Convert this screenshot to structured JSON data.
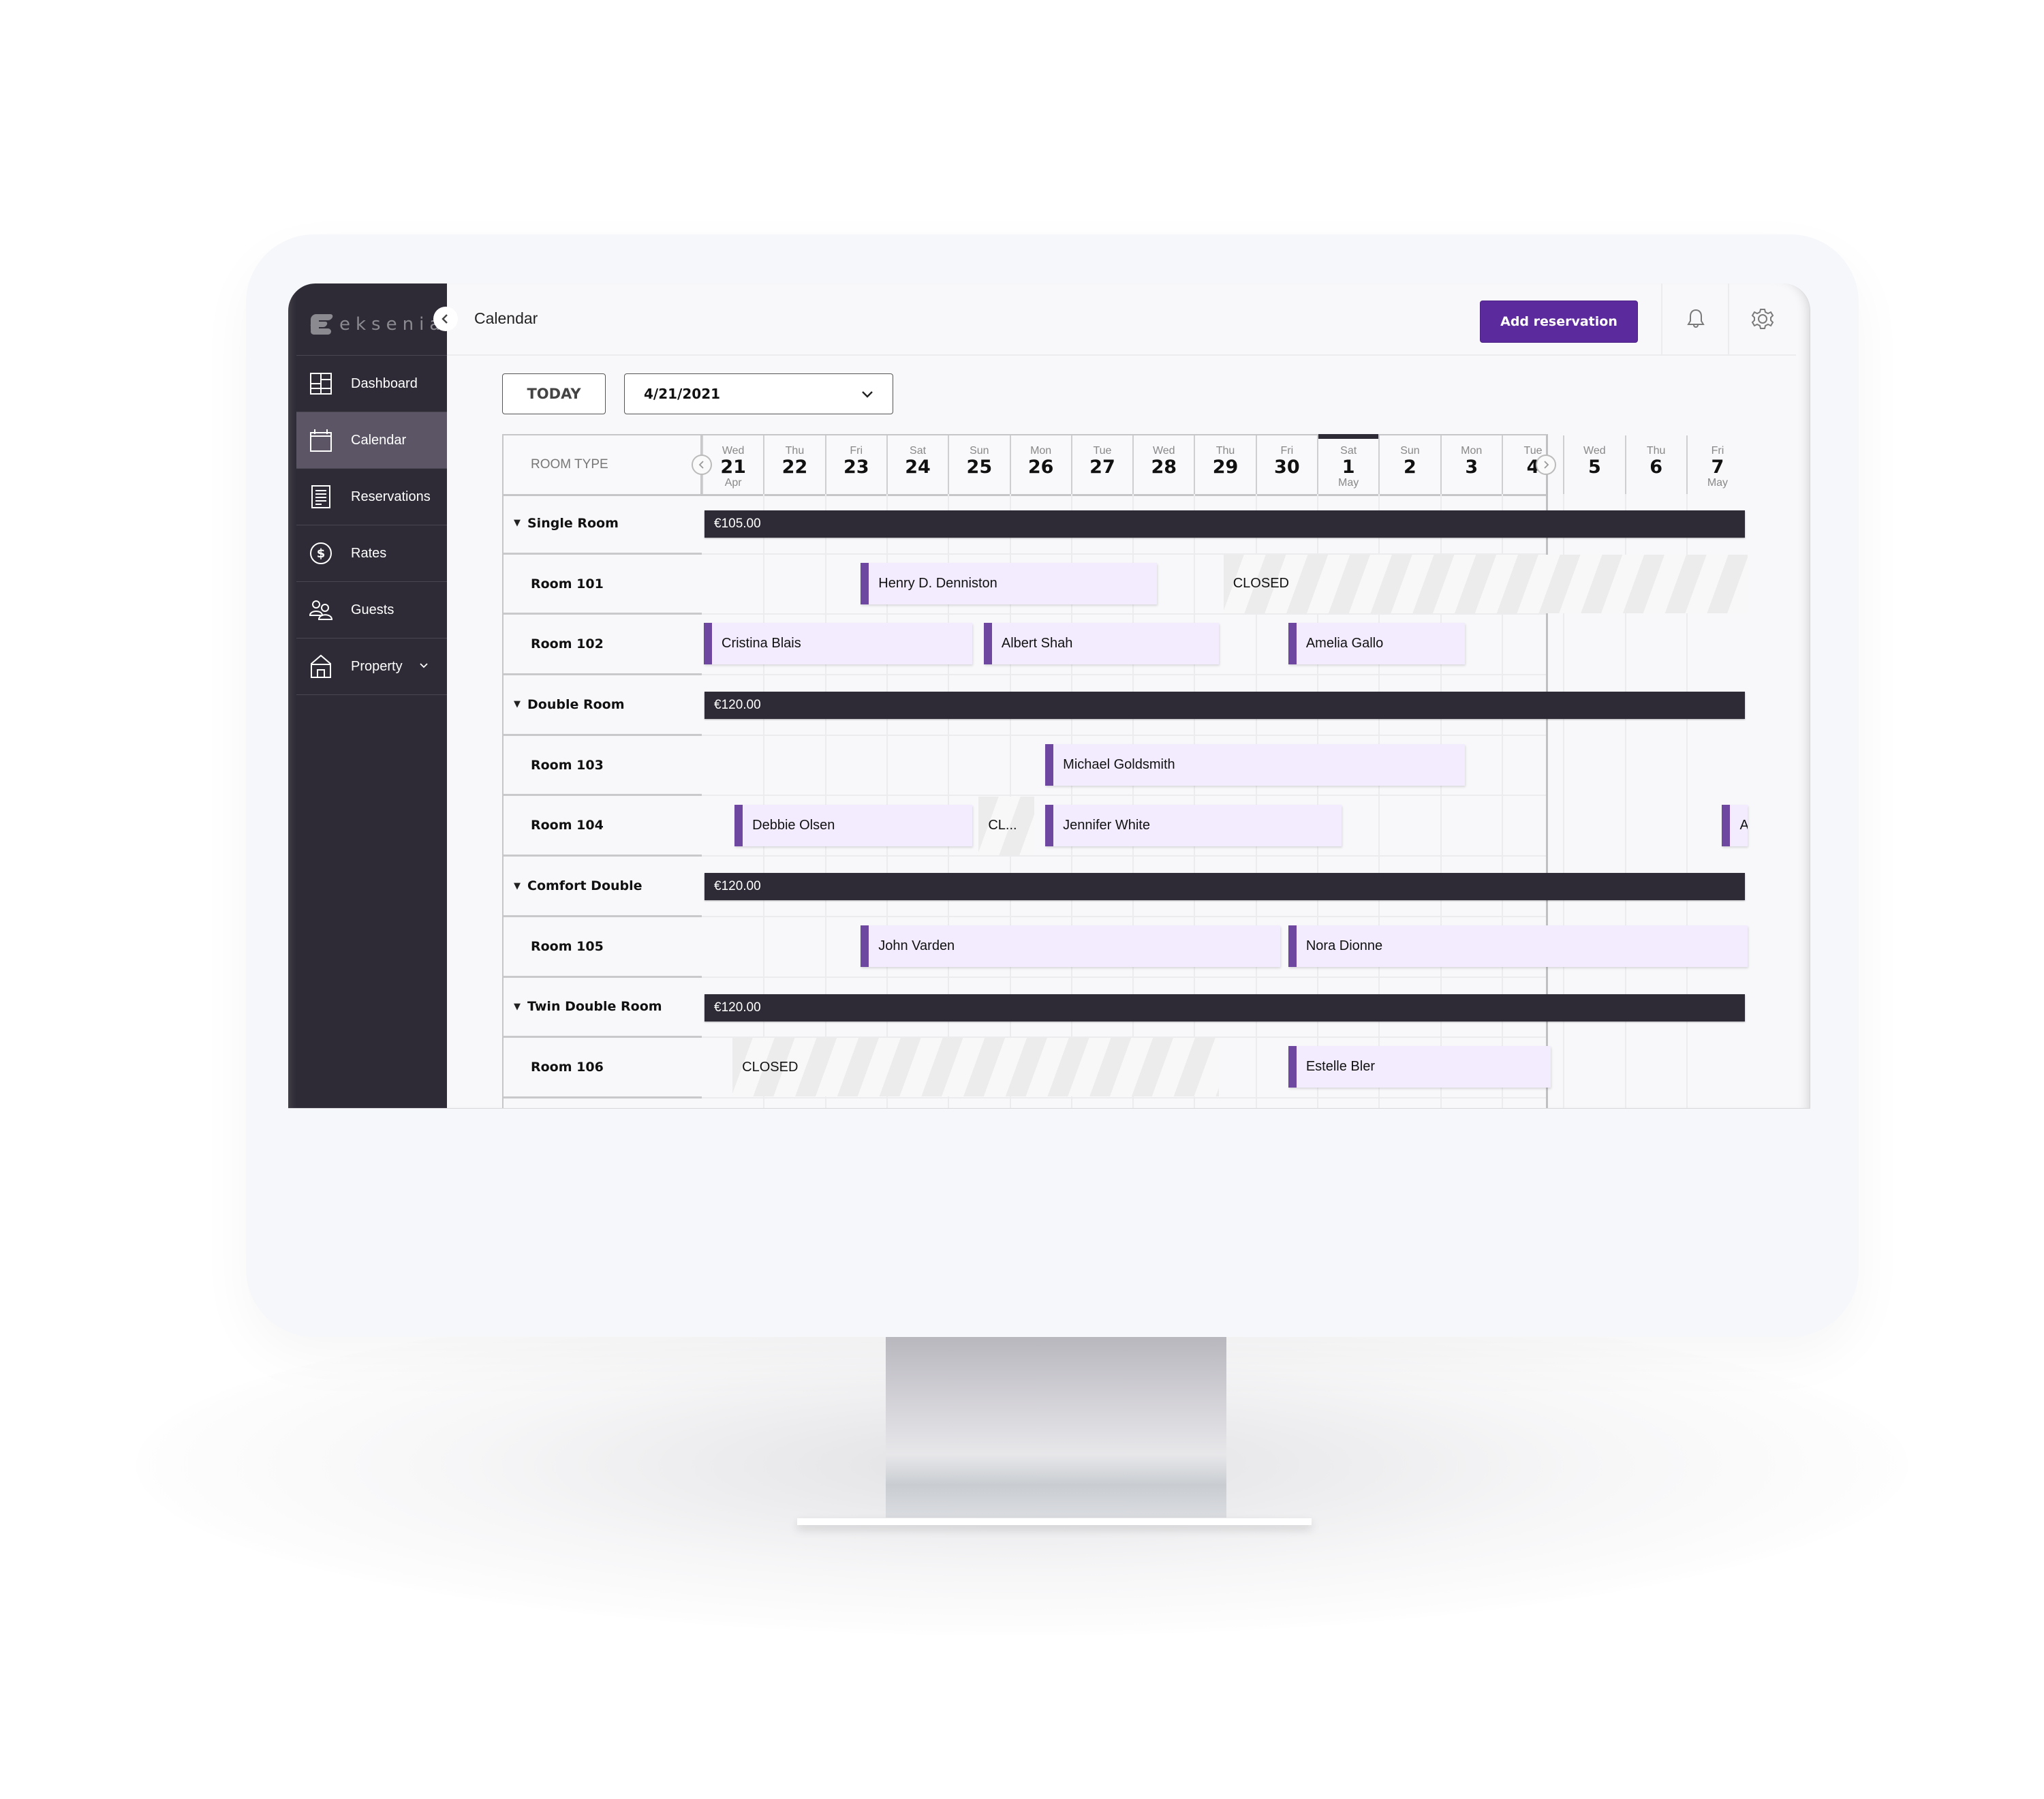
{
  "app": {
    "brand": "eksenia",
    "page_title": "Calendar"
  },
  "sidebar": {
    "items": [
      {
        "label": "Dashboard",
        "icon": "dashboard-grid-icon",
        "active": false
      },
      {
        "label": "Calendar",
        "icon": "calendar-icon",
        "active": true
      },
      {
        "label": "Reservations",
        "icon": "document-list-icon",
        "active": false
      },
      {
        "label": "Rates",
        "icon": "dollar-circle-icon",
        "active": false
      },
      {
        "label": "Guests",
        "icon": "users-icon",
        "active": false
      },
      {
        "label": "Property",
        "icon": "house-icon",
        "active": false,
        "has_submenu": true
      }
    ]
  },
  "topbar": {
    "add_reservation_label": "Add reservation",
    "notification_icon": "bell-icon",
    "settings_icon": "gear-icon",
    "accent_color": "#5b2a9c"
  },
  "toolbar": {
    "today_label": "TODAY",
    "date_value": "4/21/2021"
  },
  "calendar": {
    "room_type_header": "ROOM TYPE",
    "highlighted_day_index": 10,
    "days": [
      {
        "dow": "Wed",
        "day": "21",
        "month": "Apr"
      },
      {
        "dow": "Thu",
        "day": "22",
        "month": ""
      },
      {
        "dow": "Fri",
        "day": "23",
        "month": ""
      },
      {
        "dow": "Sat",
        "day": "24",
        "month": ""
      },
      {
        "dow": "Sun",
        "day": "25",
        "month": ""
      },
      {
        "dow": "Mon",
        "day": "26",
        "month": ""
      },
      {
        "dow": "Tue",
        "day": "27",
        "month": ""
      },
      {
        "dow": "Wed",
        "day": "28",
        "month": ""
      },
      {
        "dow": "Thu",
        "day": "29",
        "month": ""
      },
      {
        "dow": "Fri",
        "day": "30",
        "month": ""
      },
      {
        "dow": "Sat",
        "day": "1",
        "month": "May"
      },
      {
        "dow": "Sun",
        "day": "2",
        "month": ""
      },
      {
        "dow": "Mon",
        "day": "3",
        "month": ""
      },
      {
        "dow": "Tue",
        "day": "4",
        "month": ""
      },
      {
        "dow": "Wed",
        "day": "5",
        "month": ""
      },
      {
        "dow": "Thu",
        "day": "6",
        "month": ""
      },
      {
        "dow": "Fri",
        "day": "7",
        "month": "May"
      }
    ],
    "rows": [
      {
        "type": "group",
        "label": "Single Room",
        "rate": "€105.00"
      },
      {
        "type": "room",
        "label": "Room 101",
        "items": [
          {
            "kind": "booking",
            "label": "Henry D. Denniston",
            "start": 2.55,
            "end": 7.4
          },
          {
            "kind": "closed",
            "label": "CLOSED",
            "start": 8.48,
            "end": 17
          }
        ]
      },
      {
        "type": "room",
        "label": "Room 102",
        "items": [
          {
            "kind": "booking",
            "label": "Cristina Blais",
            "start": 0.0,
            "end": 4.4
          },
          {
            "kind": "booking",
            "label": "Albert Shah",
            "start": 4.55,
            "end": 8.4
          },
          {
            "kind": "booking",
            "label": "Amelia Gallo",
            "start": 9.5,
            "end": 12.4
          }
        ]
      },
      {
        "type": "group",
        "label": "Double Room",
        "rate": "€120.00"
      },
      {
        "type": "room",
        "label": "Room 103",
        "items": [
          {
            "kind": "booking",
            "label": "Michael Goldsmith",
            "start": 5.55,
            "end": 12.4
          }
        ]
      },
      {
        "type": "room",
        "label": "Room 104",
        "items": [
          {
            "kind": "booking",
            "label": "Debbie Olsen",
            "start": 0.5,
            "end": 4.4
          },
          {
            "kind": "closed",
            "label": "CL...",
            "start": 4.5,
            "end": 5.4
          },
          {
            "kind": "booking",
            "label": "Jennifer White",
            "start": 5.55,
            "end": 10.4
          },
          {
            "kind": "booking",
            "label": "A.",
            "start": 16.55,
            "end": 17
          }
        ]
      },
      {
        "type": "group",
        "label": "Comfort Double",
        "rate": "€120.00"
      },
      {
        "type": "room",
        "label": "Room 105",
        "items": [
          {
            "kind": "booking",
            "label": "John Varden",
            "start": 2.55,
            "end": 9.4
          },
          {
            "kind": "booking",
            "label": "Nora Dionne",
            "start": 9.5,
            "end": 17
          }
        ]
      },
      {
        "type": "group",
        "label": "Twin Double Room",
        "rate": "€120.00"
      },
      {
        "type": "room",
        "label": "Room 106",
        "items": [
          {
            "kind": "closed",
            "label": "CLOSED",
            "start": 0.5,
            "end": 8.4
          },
          {
            "kind": "booking",
            "label": "Estelle Bler",
            "start": 9.5,
            "end": 13.8
          }
        ]
      },
      {
        "type": "room",
        "label": "",
        "items": []
      }
    ]
  }
}
